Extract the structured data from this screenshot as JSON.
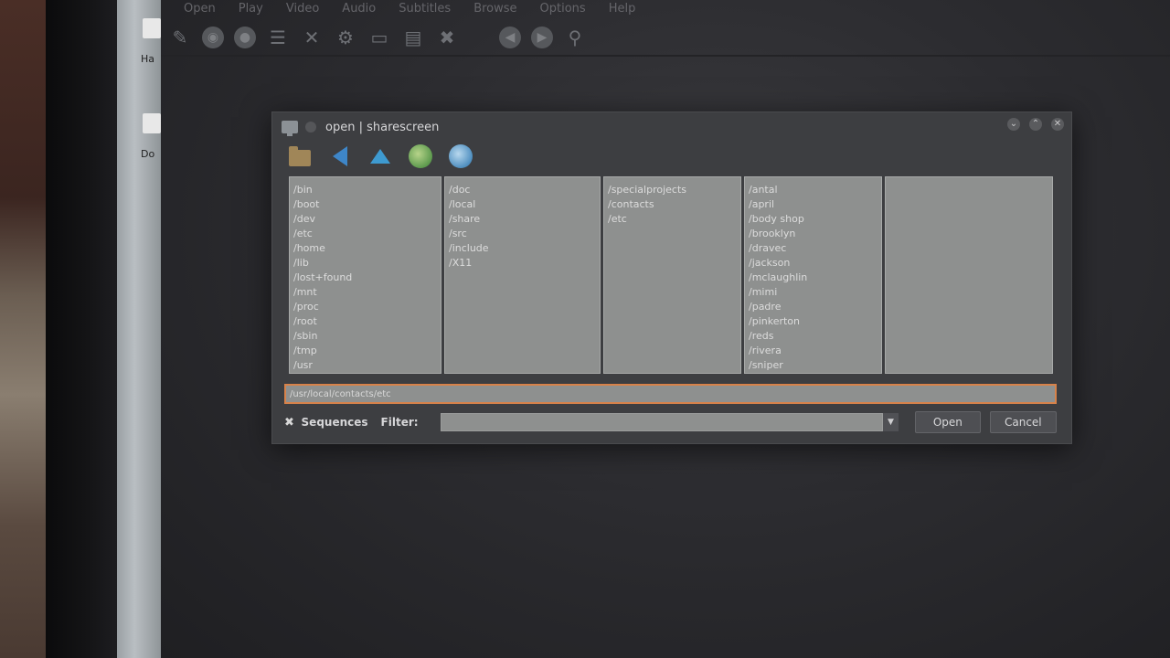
{
  "menubar": {
    "items": [
      "Open",
      "Play",
      "Video",
      "Audio",
      "Subtitles",
      "Browse",
      "Options",
      "Help"
    ]
  },
  "toolbar": {
    "icons": [
      "pin-icon",
      "disc-icon",
      "circle-icon",
      "film-icon",
      "fullscreen-icon",
      "gear-icon",
      "screen-icon",
      "document-icon",
      "tools-icon",
      "previous-icon",
      "next-icon",
      "magnifier-icon"
    ]
  },
  "desktop": {
    "icon_labels": [
      "Ha",
      "Do"
    ]
  },
  "dialog": {
    "title": "open | sharescreen",
    "window_controls": [
      "⌄",
      "⌃",
      "✕"
    ],
    "nav_icons": [
      "folder-icon",
      "back-arrow-icon",
      "up-arrow-icon",
      "history-globe-icon",
      "web-globe-icon"
    ],
    "columns": [
      [
        "/bin",
        "/boot",
        "/dev",
        "/etc",
        "/home",
        "/lib",
        "/lost+found",
        "/mnt",
        "/proc",
        "/root",
        "/sbin",
        "/tmp",
        "/usr"
      ],
      [
        "/doc",
        "/local",
        "/share",
        "/src",
        "/include",
        "/X11"
      ],
      [
        "/specialprojects",
        "/contacts",
        "/etc"
      ],
      [
        "/antal",
        "/april",
        "/body shop",
        "/brooklyn",
        "/dravec",
        "/jackson",
        "/mclaughlin",
        "/mimi",
        "/padre",
        "/pinkerton",
        "/reds",
        "/rivera",
        "/sniper"
      ],
      []
    ],
    "path_value": "/usr/local/contacts/etc",
    "sequences_checked": true,
    "sequences_label": "Sequences",
    "filter_label": "Filter:",
    "filter_value": "",
    "open_button": "Open",
    "cancel_button": "Cancel"
  },
  "colors": {
    "dialog_bg": "#3d3e41",
    "column_bg": "#8e908f",
    "path_border": "#d7824a"
  }
}
